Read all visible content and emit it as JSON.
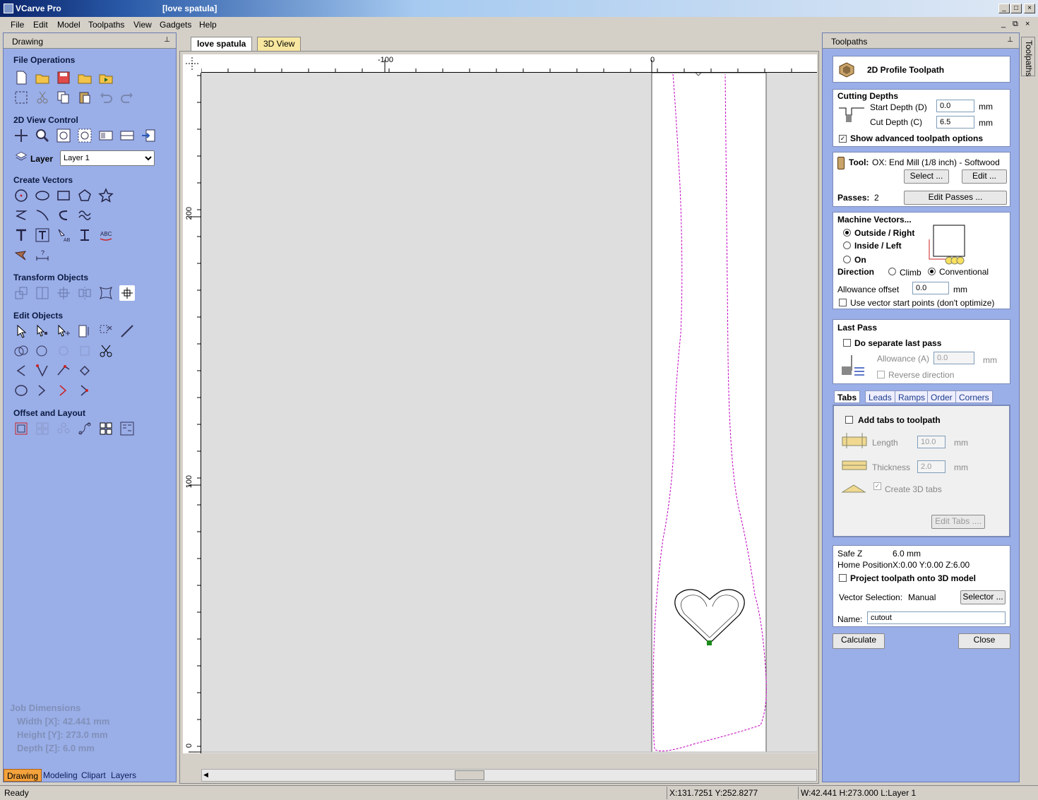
{
  "window": {
    "app_title": "VCarve Pro",
    "doc_title": "[love spatula]",
    "controls": [
      "_",
      "□",
      "×"
    ],
    "mdi_controls": [
      "_",
      "⧉",
      "×"
    ]
  },
  "menu": [
    "File",
    "Edit",
    "Model",
    "Toolpaths",
    "View",
    "Gadgets",
    "Help"
  ],
  "left_panel": {
    "title": "Drawing",
    "sections": {
      "file_ops": "File Operations",
      "view_control": "2D View Control",
      "create_vectors": "Create Vectors",
      "transform": "Transform Objects",
      "edit": "Edit Objects",
      "offset": "Offset and Layout"
    },
    "layer_label": "Layer",
    "layer_value": "Layer 1",
    "job_dimensions": {
      "title": "Job Dimensions",
      "width": "Width  [X]: 42.441 mm",
      "height": "Height [Y]: 273.0 mm",
      "depth": "Depth  [Z]: 6.0 mm"
    },
    "tabs": [
      "Drawing",
      "Modeling",
      "Clipart",
      "Layers"
    ]
  },
  "doc_tabs": [
    "love spatula",
    "3D View"
  ],
  "ruler": {
    "h_labels": [
      "-100",
      "0"
    ],
    "v_labels": [
      "200",
      "100",
      "0"
    ]
  },
  "right_panel": {
    "title": "Toolpaths",
    "vertical_tab": "Toolpaths",
    "toolpath_name": "2D Profile Toolpath",
    "cutting_depths": {
      "title": "Cutting Depths",
      "start_label": "Start Depth (D)",
      "start_value": "0.0",
      "cut_label": "Cut Depth (C)",
      "cut_value": "6.5",
      "unit": "mm",
      "advanced": "Show advanced toolpath options"
    },
    "tool": {
      "label": "Tool:",
      "name": "OX: End Mill (1/8 inch) - Softwood",
      "select": "Select ...",
      "edit": "Edit ...",
      "passes_label": "Passes:",
      "passes_value": "2",
      "edit_passes": "Edit Passes ..."
    },
    "machine_vectors": {
      "title": "Machine Vectors...",
      "outside": "Outside / Right",
      "inside": "Inside / Left",
      "on": "On",
      "direction": "Direction",
      "climb": "Climb",
      "conventional": "Conventional",
      "allowance_label": "Allowance offset",
      "allowance_value": "0.0",
      "unit": "mm",
      "start_points": "Use vector start points (don't optimize)"
    },
    "last_pass": {
      "title": "Last Pass",
      "separate": "Do separate last pass",
      "allowance_label": "Allowance (A)",
      "allowance_value": "0.0",
      "unit": "mm",
      "reverse": "Reverse direction"
    },
    "tabs": [
      "Tabs",
      "Leads",
      "Ramps",
      "Order",
      "Corners"
    ],
    "tabs_panel": {
      "add": "Add tabs to toolpath",
      "length_label": "Length",
      "length_value": "10.0",
      "thickness_label": "Thickness",
      "thickness_value": "2.0",
      "unit": "mm",
      "create3d": "Create 3D tabs",
      "edit_tabs": "Edit Tabs ...."
    },
    "info": {
      "safez_label": "Safe Z",
      "safez_value": "6.0 mm",
      "home_label": "Home Position",
      "home_value": "X:0.00 Y:0.00 Z:6.00",
      "project": "Project toolpath onto 3D model",
      "vector_sel_label": "Vector Selection:",
      "vector_sel_value": "Manual",
      "selector": "Selector ...",
      "name_label": "Name:",
      "name_value": "cutout"
    },
    "calculate": "Calculate",
    "close": "Close"
  },
  "status": {
    "ready": "Ready",
    "coords": "X:131.7251 Y:252.8277",
    "dims": "W:42.441   H:273.000  L:Layer 1"
  }
}
